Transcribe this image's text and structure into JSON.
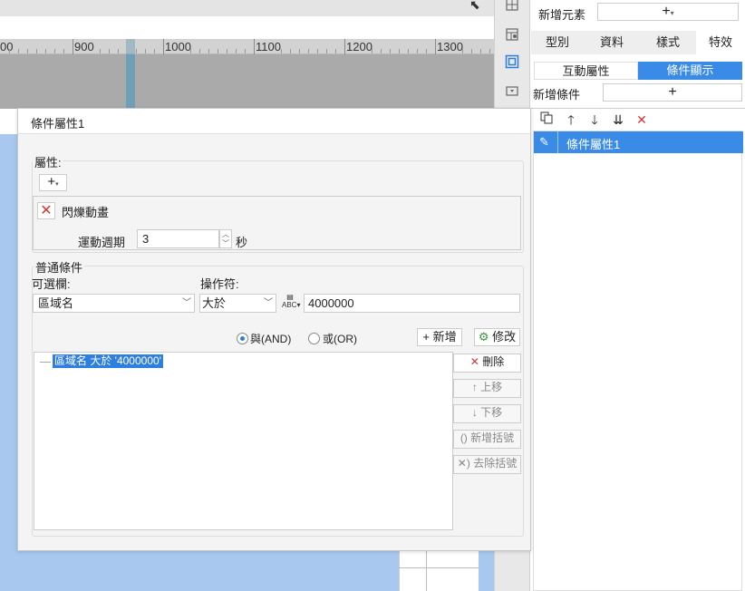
{
  "ruler": {
    "labels": [
      "00",
      "900",
      "1000",
      "1100",
      "1200",
      "1300"
    ]
  },
  "right_panel": {
    "new_element_label": "新增元素",
    "new_element_button": "+",
    "tabs": [
      "型別",
      "資料",
      "樣式",
      "特效"
    ],
    "active_tab": "特效",
    "subtabs": [
      "互動屬性",
      "條件顯示"
    ],
    "active_subtab": "條件顯示",
    "new_condition_label": "新增條件",
    "new_condition_button": "+",
    "condition_items": [
      "條件屬性1"
    ]
  },
  "dialog": {
    "title": "條件屬性1",
    "properties_label": "屬性:",
    "add_property_button": "+",
    "property_name": "閃爍動畫",
    "period_label": "運動週期",
    "period_value": "3",
    "period_unit": "秒",
    "condition_group_label": "普通條件",
    "field_label": "可選欄:",
    "operator_label": "操作符:",
    "field_value": "區域名",
    "operator_value": "大於",
    "value_text": "4000000",
    "and_label": "與(AND)",
    "or_label": "或(OR)",
    "logic_selected": "AND",
    "add_button": "新增",
    "modify_button": "修改",
    "condition_expression": "區域名 大於 '4000000'",
    "delete_button": "刪除",
    "up_button": "上移",
    "down_button": "下移",
    "add_bracket_button": "新增括號",
    "remove_bracket_button": "去除括號"
  },
  "colors": {
    "accent": "#3a8be8",
    "canvas_blue": "#a8c8f0",
    "delete_red": "#d33333"
  }
}
